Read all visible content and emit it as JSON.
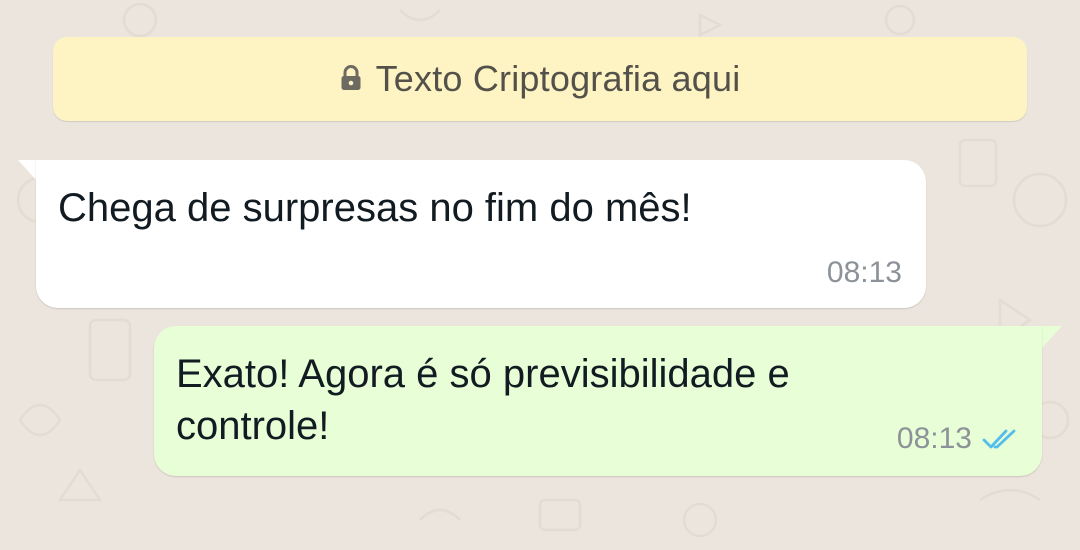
{
  "banner": {
    "icon": "lock-icon",
    "text": "Texto Criptografia aqui"
  },
  "messages": [
    {
      "direction": "incoming",
      "text": "Chega de surpresas no fim do mês!",
      "time": "08:13"
    },
    {
      "direction": "outgoing",
      "text": "Exato! Agora é só previsibilidade e controle!",
      "time": "08:13",
      "status_icon": "double-check-read-icon"
    }
  ],
  "colors": {
    "background": "#ece5dd",
    "banner": "#fdf3c3",
    "incoming_bubble": "#ffffff",
    "outgoing_bubble": "#e7fed6",
    "read_ticks": "#53bdeb",
    "timestamp": "#8c9298"
  }
}
